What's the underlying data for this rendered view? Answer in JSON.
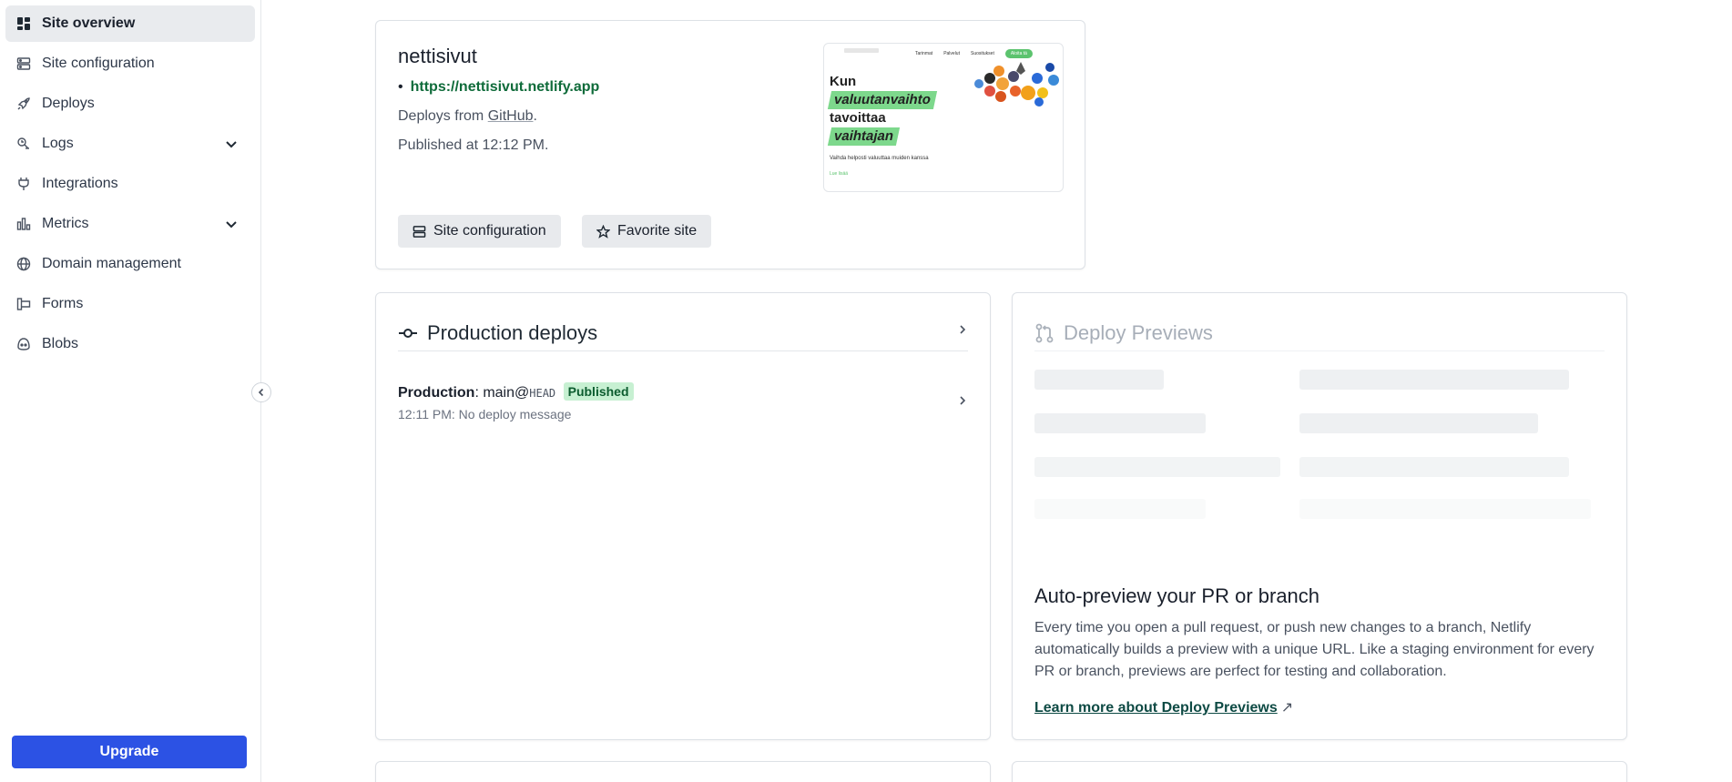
{
  "sidebar": {
    "items": [
      {
        "label": "Site overview",
        "icon": "dashboard-icon"
      },
      {
        "label": "Site configuration",
        "icon": "server-icon"
      },
      {
        "label": "Deploys",
        "icon": "rocket-icon"
      },
      {
        "label": "Logs",
        "icon": "logs-icon"
      },
      {
        "label": "Integrations",
        "icon": "plug-icon"
      },
      {
        "label": "Metrics",
        "icon": "bar-chart-icon"
      },
      {
        "label": "Domain management",
        "icon": "globe-icon"
      },
      {
        "label": "Forms",
        "icon": "forms-icon"
      },
      {
        "label": "Blobs",
        "icon": "blobs-icon"
      }
    ],
    "upgrade_label": "Upgrade"
  },
  "site": {
    "name": "nettisivut",
    "url": "https://nettisivut.netlify.app",
    "deploys_from_prefix": "Deploys from ",
    "deploys_from_source": "GitHub",
    "deploys_from_suffix": ".",
    "published": "Published at 12:12 PM.",
    "site_config_button": "Site configuration",
    "favorite_button": "Favorite site",
    "thumbnail": {
      "nav_items": [
        "Tarinmat",
        "Palvelut",
        "Suositukset",
        "Aloita tä"
      ],
      "headline": [
        "Kun",
        "valuutanvaihto",
        "tavoittaa",
        "vaihtajan"
      ],
      "subtext": "Vaihda helposti valuuttaa muiden kanssa",
      "link": "Lue lisää"
    }
  },
  "production": {
    "title": "Production deploys",
    "deploy_label": "Production",
    "deploy_branch": "main@",
    "deploy_ref": "HEAD",
    "badge": "Published",
    "deploy_message": "12:11 PM: No deploy message"
  },
  "previews": {
    "title": "Deploy Previews",
    "heading": "Auto-preview your PR or branch",
    "body": "Every time you open a pull request, or push new changes to a branch, Netlify automatically builds a preview with a unique URL. Like a staging environment for every PR or branch, previews are perfect for testing and collaboration.",
    "link": "Learn more about Deploy Previews"
  },
  "colors": {
    "primary": "#2c52e4",
    "success_bg": "#c7f0d2",
    "success_text": "#0c5c2f",
    "link_green": "#0f6b3a"
  }
}
